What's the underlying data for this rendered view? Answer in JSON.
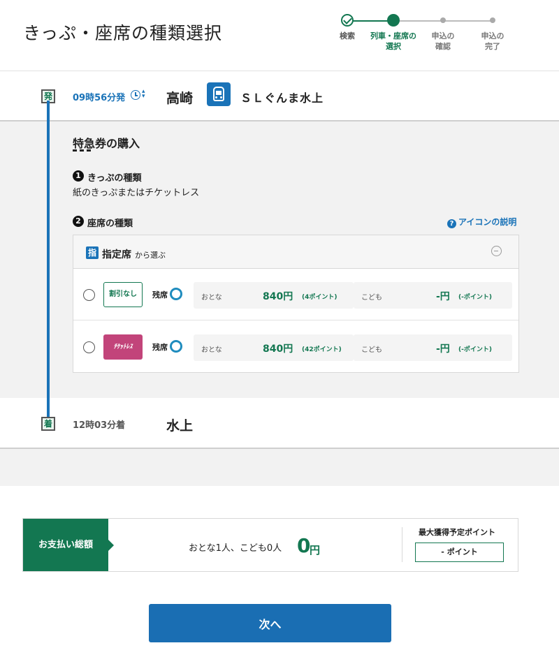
{
  "header": {
    "title": "きっぷ・座席の種類選択",
    "steps": [
      {
        "label": "検索",
        "state": "done"
      },
      {
        "label": "列車・座席の\n選択",
        "state": "current"
      },
      {
        "label": "申込の\n確認",
        "state": "future"
      },
      {
        "label": "申込の\n完了",
        "state": "future"
      }
    ]
  },
  "departure": {
    "badge": "発",
    "time": "09時56分発",
    "station": "高崎",
    "train_icon": "train-icon",
    "train_name": "ＳＬぐんま水上"
  },
  "express": {
    "title": "特急券の購入",
    "ticket_type": {
      "num": "1",
      "title": "きっぷの種類",
      "value": "紙のきっぷまたはチケットレス"
    },
    "seat_type": {
      "num": "2",
      "title": "座席の種類",
      "help_link": "アイコンの説明"
    },
    "panel": {
      "icon_char": "指",
      "label": "指定席",
      "sub": "から選ぶ",
      "rows": [
        {
          "ticket": "割引なし",
          "ticket_style": "plain",
          "vacancy": "残席",
          "adult_label": "おとな",
          "adult_price": "840円",
          "adult_points": "(4ポイント)",
          "child_label": "こども",
          "child_price": "-円",
          "child_points": "(-ポイント)"
        },
        {
          "ticket": "ﾁｹｯﾄﾚｽ",
          "ticket_style": "ticketless",
          "vacancy": "残席",
          "adult_label": "おとな",
          "adult_price": "840円",
          "adult_points": "(42ポイント)",
          "child_label": "こども",
          "child_price": "-円",
          "child_points": "(-ポイント)"
        }
      ]
    }
  },
  "arrival": {
    "badge": "着",
    "time": "12時03分着",
    "station": "水上"
  },
  "payment": {
    "label": "お支払い総額",
    "count": "おとな1人、こども0人",
    "amount": "0",
    "unit": "円",
    "points_title": "最大獲得予定ポイント",
    "points_value": "- ポイント"
  },
  "next_button": "次へ",
  "colors": {
    "brand_green": "#137751",
    "brand_blue": "#1a73b8",
    "ticketless_pink": "#c2447a"
  }
}
